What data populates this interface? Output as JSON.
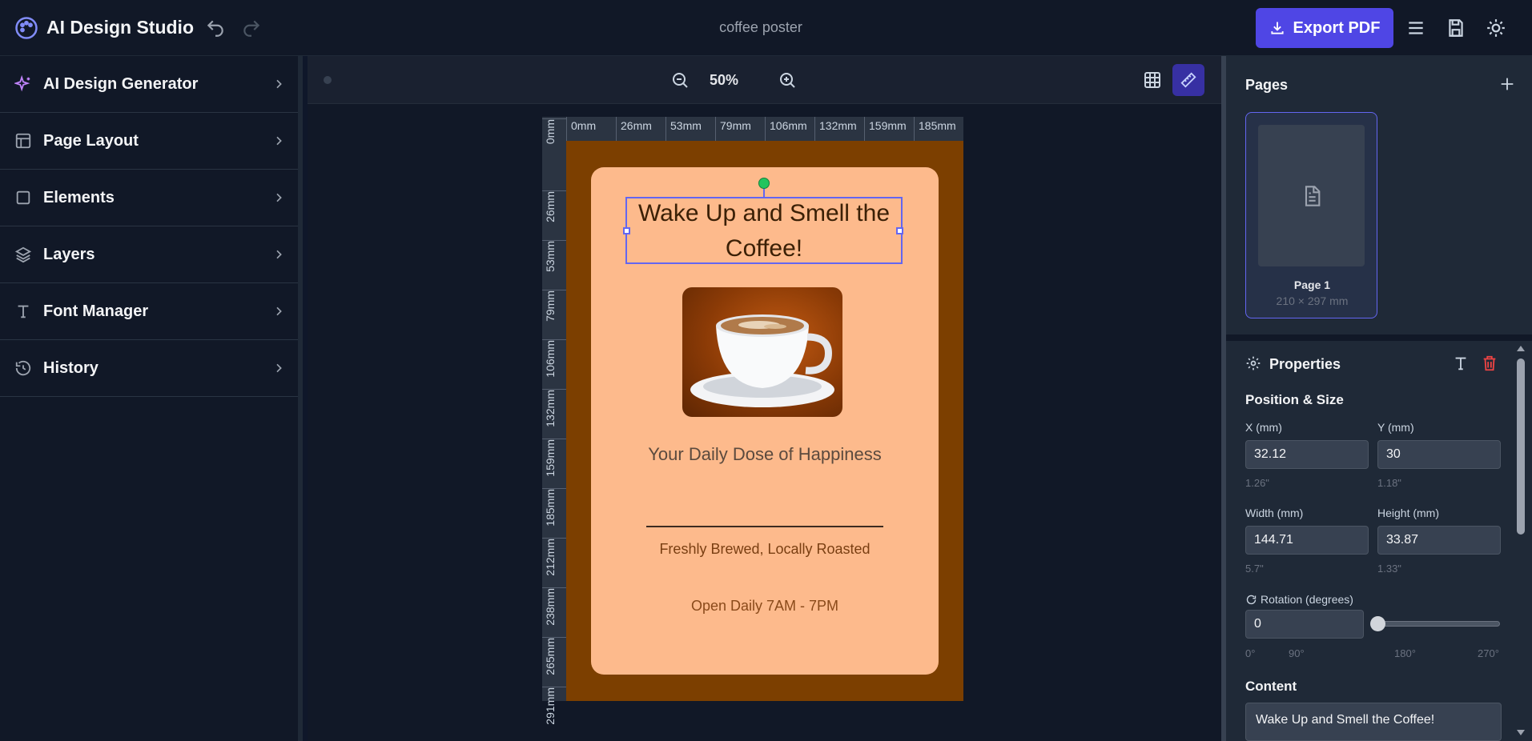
{
  "header": {
    "app_title": "AI Design Studio",
    "document_name": "coffee poster",
    "export_label": "Export PDF",
    "icons": [
      "palette-icon",
      "undo-icon",
      "redo-icon",
      "download-icon",
      "menu-icon",
      "save-icon",
      "sun-icon"
    ]
  },
  "sidebar": {
    "items": [
      {
        "label": "AI Design Generator",
        "icon": "sparkles-icon"
      },
      {
        "label": "Page Layout",
        "icon": "layout-icon"
      },
      {
        "label": "Elements",
        "icon": "square-icon"
      },
      {
        "label": "Layers",
        "icon": "layers-icon"
      },
      {
        "label": "Font Manager",
        "icon": "type-icon"
      },
      {
        "label": "History",
        "icon": "history-icon"
      }
    ]
  },
  "canvas": {
    "zoom": "50%",
    "ruler_top": [
      "0mm",
      "26mm",
      "53mm",
      "79mm",
      "106mm",
      "132mm",
      "159mm",
      "185mm"
    ],
    "ruler_left": [
      "0mm",
      "26mm",
      "53mm",
      "79mm",
      "106mm",
      "132mm",
      "159mm",
      "185mm",
      "212mm",
      "238mm",
      "265mm",
      "291mm"
    ]
  },
  "poster": {
    "headline": "Wake Up and Smell the Coffee!",
    "tagline": "Your Daily Dose of Happiness",
    "subline": "Freshly Brewed, Locally Roasted",
    "hours": "Open Daily 7AM - 7PM",
    "colors": {
      "background": "#7c3f00",
      "card": "#fdba8c",
      "selection": "#6366f1"
    }
  },
  "pages_panel": {
    "title": "Pages",
    "pages": [
      {
        "label": "Page 1",
        "size": "210 × 297 mm"
      }
    ]
  },
  "properties": {
    "title": "Properties",
    "position_size_title": "Position & Size",
    "x_label": "X (mm)",
    "x_value": "32.12",
    "x_hint": "1.26\"",
    "y_label": "Y (mm)",
    "y_value": "30",
    "y_hint": "1.18\"",
    "width_label": "Width (mm)",
    "width_value": "144.71",
    "width_hint": "5.7\"",
    "height_label": "Height (mm)",
    "height_value": "33.87",
    "height_hint": "1.33\"",
    "rotation_label": "Rotation (degrees)",
    "rotation_value": "0",
    "rotation_ticks": [
      "0°",
      "90°",
      "180°",
      "270°"
    ],
    "content_title": "Content",
    "content_value": "Wake Up and Smell the Coffee!"
  }
}
